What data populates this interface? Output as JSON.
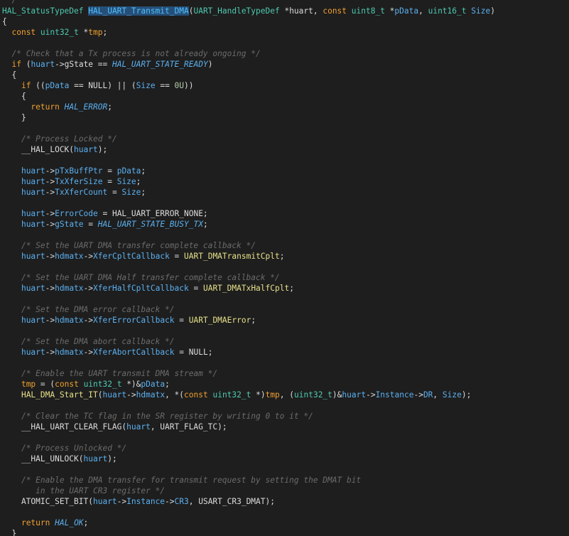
{
  "editor": {
    "language": "C",
    "colors": {
      "background": "#1e1e1e",
      "plain": "#dcdcdc",
      "type": "#4ec9b0",
      "keyword": "#f0a030",
      "function": "#4fc1ff",
      "variable": "#5bb0f0",
      "comment": "#6b6b6b",
      "macro": "#e6e08a",
      "selection": "#264f78"
    },
    "lines": [
      [
        [
          "cm",
          "  /"
        ]
      ],
      [
        [
          "ty",
          "HAL_StatusTypeDef"
        ],
        [
          "pl",
          " "
        ],
        [
          "fnhl",
          "HAL_UART_Transmit_DMA"
        ],
        [
          "pl",
          "("
        ],
        [
          "ty",
          "UART_HandleTypeDef"
        ],
        [
          "pl",
          " *huart, "
        ],
        [
          "kw",
          "const"
        ],
        [
          "pl",
          " "
        ],
        [
          "ty",
          "uint8_t"
        ],
        [
          "pl",
          " *"
        ],
        [
          "var",
          "pData"
        ],
        [
          "pl",
          ", "
        ],
        [
          "ty",
          "uint16_t"
        ],
        [
          "pl",
          " "
        ],
        [
          "var",
          "Size"
        ],
        [
          "pl",
          ")"
        ]
      ],
      [
        [
          "pl",
          "{"
        ]
      ],
      [
        [
          "pl",
          "  "
        ],
        [
          "kw",
          "const"
        ],
        [
          "pl",
          " "
        ],
        [
          "ty",
          "uint32_t"
        ],
        [
          "pl",
          " *"
        ],
        [
          "kw",
          "tmp"
        ],
        [
          "pl",
          ";"
        ]
      ],
      [
        [
          "pl",
          ""
        ]
      ],
      [
        [
          "pl",
          "  "
        ],
        [
          "cm",
          "/* Check that a Tx process is not already ongoing */"
        ]
      ],
      [
        [
          "pl",
          "  "
        ],
        [
          "kw",
          "if"
        ],
        [
          "pl",
          " ("
        ],
        [
          "var",
          "huart"
        ],
        [
          "op",
          "->"
        ],
        [
          "pl",
          "gState == "
        ],
        [
          "dc",
          "HAL_UART_STATE_READY"
        ],
        [
          "pl",
          ")"
        ]
      ],
      [
        [
          "pl",
          "  {"
        ]
      ],
      [
        [
          "pl",
          "    "
        ],
        [
          "kw",
          "if"
        ],
        [
          "pl",
          " (("
        ],
        [
          "var",
          "pData"
        ],
        [
          "pl",
          " == NULL) || ("
        ],
        [
          "var",
          "Size"
        ],
        [
          "pl",
          " == "
        ],
        [
          "num",
          "0U"
        ],
        [
          "pl",
          "))"
        ]
      ],
      [
        [
          "pl",
          "    {"
        ]
      ],
      [
        [
          "pl",
          "      "
        ],
        [
          "kw",
          "return"
        ],
        [
          "pl",
          " "
        ],
        [
          "dc",
          "HAL_ERROR"
        ],
        [
          "pl",
          ";"
        ]
      ],
      [
        [
          "pl",
          "    }"
        ]
      ],
      [
        [
          "pl",
          ""
        ]
      ],
      [
        [
          "pl",
          "    "
        ],
        [
          "cm",
          "/* Process Locked */"
        ]
      ],
      [
        [
          "pl",
          "    __HAL_LOCK("
        ],
        [
          "var",
          "huart"
        ],
        [
          "pl",
          ");"
        ]
      ],
      [
        [
          "pl",
          ""
        ]
      ],
      [
        [
          "pl",
          "    "
        ],
        [
          "var",
          "huart"
        ],
        [
          "op",
          "->"
        ],
        [
          "var",
          "pTxBuffPtr"
        ],
        [
          "pl",
          " = "
        ],
        [
          "var",
          "pData"
        ],
        [
          "pl",
          ";"
        ]
      ],
      [
        [
          "pl",
          "    "
        ],
        [
          "var",
          "huart"
        ],
        [
          "op",
          "->"
        ],
        [
          "var",
          "TxXferSize"
        ],
        [
          "pl",
          " = "
        ],
        [
          "var",
          "Size"
        ],
        [
          "pl",
          ";"
        ]
      ],
      [
        [
          "pl",
          "    "
        ],
        [
          "var",
          "huart"
        ],
        [
          "op",
          "->"
        ],
        [
          "var",
          "TxXferCount"
        ],
        [
          "pl",
          " = "
        ],
        [
          "var",
          "Size"
        ],
        [
          "pl",
          ";"
        ]
      ],
      [
        [
          "pl",
          ""
        ]
      ],
      [
        [
          "pl",
          "    "
        ],
        [
          "var",
          "huart"
        ],
        [
          "op",
          "->"
        ],
        [
          "var",
          "ErrorCode"
        ],
        [
          "pl",
          " = HAL_UART_ERROR_NONE;"
        ]
      ],
      [
        [
          "pl",
          "    "
        ],
        [
          "var",
          "huart"
        ],
        [
          "op",
          "->"
        ],
        [
          "var",
          "gState"
        ],
        [
          "pl",
          " = "
        ],
        [
          "dc",
          "HAL_UART_STATE_BUSY_TX"
        ],
        [
          "pl",
          ";"
        ]
      ],
      [
        [
          "pl",
          ""
        ]
      ],
      [
        [
          "pl",
          "    "
        ],
        [
          "cm",
          "/* Set the UART DMA transfer complete callback */"
        ]
      ],
      [
        [
          "pl",
          "    "
        ],
        [
          "var",
          "huart"
        ],
        [
          "op",
          "->"
        ],
        [
          "var",
          "hdmatx"
        ],
        [
          "op",
          "->"
        ],
        [
          "var",
          "XferCpltCallback"
        ],
        [
          "pl",
          " = "
        ],
        [
          "mac",
          "UART_DMATransmitCplt"
        ],
        [
          "pl",
          ";"
        ]
      ],
      [
        [
          "pl",
          ""
        ]
      ],
      [
        [
          "pl",
          "    "
        ],
        [
          "cm",
          "/* Set the UART DMA Half transfer complete callback */"
        ]
      ],
      [
        [
          "pl",
          "    "
        ],
        [
          "var",
          "huart"
        ],
        [
          "op",
          "->"
        ],
        [
          "var",
          "hdmatx"
        ],
        [
          "op",
          "->"
        ],
        [
          "var",
          "XferHalfCpltCallback"
        ],
        [
          "pl",
          " = "
        ],
        [
          "mac",
          "UART_DMATxHalfCplt"
        ],
        [
          "pl",
          ";"
        ]
      ],
      [
        [
          "pl",
          ""
        ]
      ],
      [
        [
          "pl",
          "    "
        ],
        [
          "cm",
          "/* Set the DMA error callback */"
        ]
      ],
      [
        [
          "pl",
          "    "
        ],
        [
          "var",
          "huart"
        ],
        [
          "op",
          "->"
        ],
        [
          "var",
          "hdmatx"
        ],
        [
          "op",
          "->"
        ],
        [
          "var",
          "XferErrorCallback"
        ],
        [
          "pl",
          " = "
        ],
        [
          "mac",
          "UART_DMAError"
        ],
        [
          "pl",
          ";"
        ]
      ],
      [
        [
          "pl",
          ""
        ]
      ],
      [
        [
          "pl",
          "    "
        ],
        [
          "cm",
          "/* Set the DMA abort callback */"
        ]
      ],
      [
        [
          "pl",
          "    "
        ],
        [
          "var",
          "huart"
        ],
        [
          "op",
          "->"
        ],
        [
          "var",
          "hdmatx"
        ],
        [
          "op",
          "->"
        ],
        [
          "var",
          "XferAbortCallback"
        ],
        [
          "pl",
          " = NULL;"
        ]
      ],
      [
        [
          "pl",
          ""
        ]
      ],
      [
        [
          "pl",
          "    "
        ],
        [
          "cm",
          "/* Enable the UART transmit DMA stream */"
        ]
      ],
      [
        [
          "pl",
          "    "
        ],
        [
          "kw",
          "tmp"
        ],
        [
          "pl",
          " = ("
        ],
        [
          "kw",
          "const"
        ],
        [
          "pl",
          " "
        ],
        [
          "ty",
          "uint32_t"
        ],
        [
          "pl",
          " *)&"
        ],
        [
          "var",
          "pData"
        ],
        [
          "pl",
          ";"
        ]
      ],
      [
        [
          "pl",
          "    "
        ],
        [
          "mac",
          "HAL_DMA_Start_IT"
        ],
        [
          "pl",
          "("
        ],
        [
          "var",
          "huart"
        ],
        [
          "op",
          "->"
        ],
        [
          "var",
          "hdmatx"
        ],
        [
          "pl",
          ", *("
        ],
        [
          "kw",
          "const"
        ],
        [
          "pl",
          " "
        ],
        [
          "ty",
          "uint32_t"
        ],
        [
          "pl",
          " *)"
        ],
        [
          "kw",
          "tmp"
        ],
        [
          "pl",
          ", ("
        ],
        [
          "ty",
          "uint32_t"
        ],
        [
          "pl",
          ")&"
        ],
        [
          "var",
          "huart"
        ],
        [
          "op",
          "->"
        ],
        [
          "var",
          "Instance"
        ],
        [
          "op",
          "->"
        ],
        [
          "var",
          "DR"
        ],
        [
          "pl",
          ", "
        ],
        [
          "var",
          "Size"
        ],
        [
          "pl",
          ");"
        ]
      ],
      [
        [
          "pl",
          ""
        ]
      ],
      [
        [
          "pl",
          "    "
        ],
        [
          "cm",
          "/* Clear the TC flag in the SR register by writing 0 to it */"
        ]
      ],
      [
        [
          "pl",
          "    __HAL_UART_CLEAR_FLAG("
        ],
        [
          "var",
          "huart"
        ],
        [
          "pl",
          ", UART_FLAG_TC);"
        ]
      ],
      [
        [
          "pl",
          ""
        ]
      ],
      [
        [
          "pl",
          "    "
        ],
        [
          "cm",
          "/* Process Unlocked */"
        ]
      ],
      [
        [
          "pl",
          "    __HAL_UNLOCK("
        ],
        [
          "var",
          "huart"
        ],
        [
          "pl",
          ");"
        ]
      ],
      [
        [
          "pl",
          ""
        ]
      ],
      [
        [
          "pl",
          "    "
        ],
        [
          "cm",
          "/* Enable the DMA transfer for transmit request by setting the DMAT bit"
        ]
      ],
      [
        [
          "pl",
          "       "
        ],
        [
          "cm",
          "in the UART CR3 register */"
        ]
      ],
      [
        [
          "pl",
          "    ATOMIC_SET_BIT("
        ],
        [
          "var",
          "huart"
        ],
        [
          "op",
          "->"
        ],
        [
          "var",
          "Instance"
        ],
        [
          "op",
          "->"
        ],
        [
          "var",
          "CR3"
        ],
        [
          "pl",
          ", USART_CR3_DMAT);"
        ]
      ],
      [
        [
          "pl",
          ""
        ]
      ],
      [
        [
          "pl",
          "    "
        ],
        [
          "kw",
          "return"
        ],
        [
          "pl",
          " "
        ],
        [
          "dc",
          "HAL_OK"
        ],
        [
          "pl",
          ";"
        ]
      ],
      [
        [
          "pl",
          "  }"
        ]
      ]
    ]
  }
}
